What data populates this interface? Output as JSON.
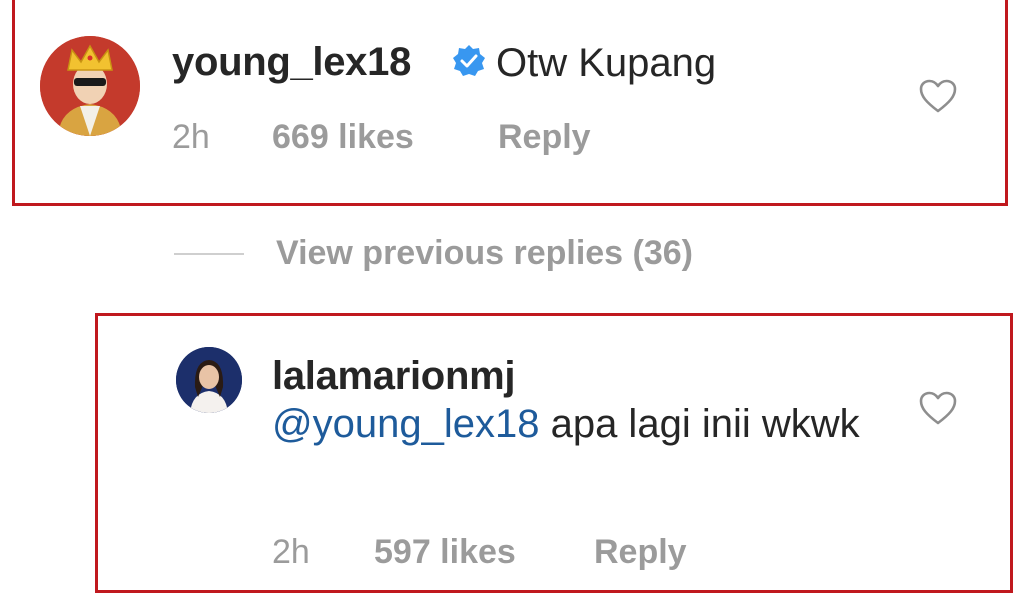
{
  "comment_1": {
    "username": "young_lex18",
    "verified_icon": "verified-badge-icon",
    "text": "Otw Kupang",
    "time": "2h",
    "likes": "669 likes",
    "reply_label": "Reply"
  },
  "view_replies": {
    "label": "View previous replies (36)"
  },
  "comment_2": {
    "username": "lalamarionmj",
    "mention": "@young_lex18",
    "text": " apa lagi inii wkwk",
    "time": "2h",
    "likes": "597 likes",
    "reply_label": "Reply"
  },
  "colors": {
    "highlight": "#c0181e",
    "verified": "#3897f0",
    "mention": "#1e5b9b",
    "meta": "#9b9b9b"
  }
}
